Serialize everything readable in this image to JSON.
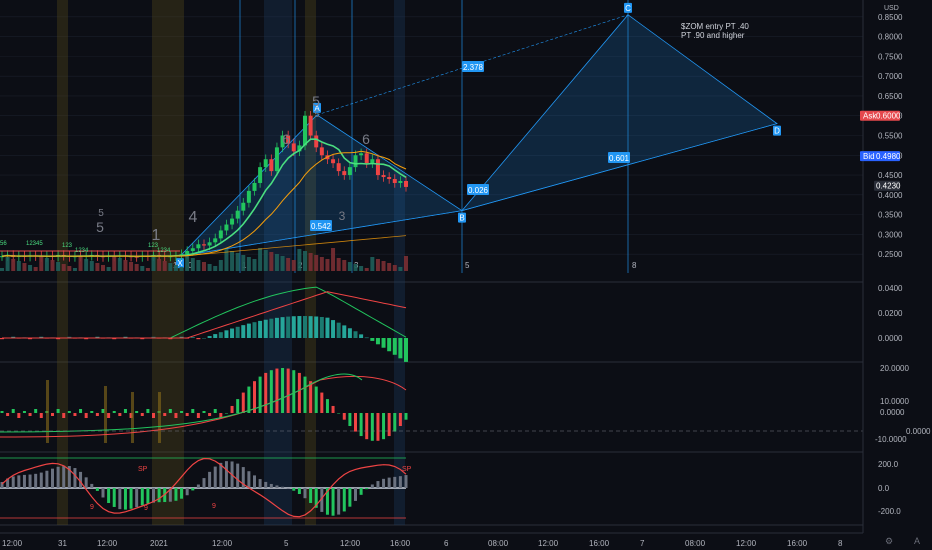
{
  "currency_label": "USD",
  "annotation": {
    "line1": "$ZOM entry PT .40",
    "line2": "PT .90 and higher"
  },
  "bid_ask": {
    "ask_label": "Ask",
    "ask_value": "0.6000",
    "bid_label": "Bid",
    "bid_value": "0.4980",
    "last_value": "0.4230",
    "ask_color": "#e5484d",
    "bid_color": "#2962ff"
  },
  "icons": {
    "settings": "gear-icon",
    "scale_toggle": "auto-scale-icon"
  },
  "colors": {
    "background": "#0c0e15",
    "up": "#22c55e",
    "down": "#ef4444",
    "pattern": "#2196f3",
    "fib_label_bg": "#2196f3"
  },
  "price_axis": {
    "labels": [
      "0.8500",
      "0.8000",
      "0.7500",
      "0.7000",
      "0.6500",
      "0.6000",
      "0.5500",
      "0.5000",
      "0.4500",
      "0.4000",
      "0.3500",
      "0.3000",
      "0.2500"
    ]
  },
  "time_axis": {
    "labels": [
      "12:00",
      "31",
      "12:00",
      "2021",
      "12:00",
      "5",
      "12:00",
      "16:00",
      "6",
      "08:00",
      "12:00",
      "16:00",
      "7",
      "08:00",
      "12:00",
      "16:00",
      "8"
    ]
  },
  "harmonic_pattern": {
    "points": [
      "X",
      "A",
      "B",
      "C",
      "D"
    ],
    "ratios": [
      "2.378",
      "0.542",
      "0.026",
      "0.601"
    ]
  },
  "wave_counts": [
    "5",
    "5",
    "1",
    "4",
    "6",
    "5",
    "6",
    "3",
    "5"
  ],
  "vertical_markers": [
    "5",
    "8",
    "1",
    "2",
    "3",
    "0",
    "1"
  ],
  "td_counts": [
    "56",
    "12345",
    "123",
    "1234",
    "123",
    "1234"
  ],
  "panes": [
    {
      "name": "macd",
      "axis_labels": [
        "0.0400",
        "0.0200",
        "0.0000"
      ]
    },
    {
      "name": "oscillator",
      "axis_labels": [
        "20.0000",
        "10.0000",
        "0.0000",
        "-10.0000"
      ],
      "side_label": "0.0000"
    },
    {
      "name": "cci",
      "axis_labels": [
        "200.0",
        "0.0",
        "-200.0"
      ],
      "markers": [
        "SP",
        "9",
        "9",
        "9",
        "SP"
      ]
    }
  ],
  "chart_data": {
    "type": "candlestick",
    "symbol": "ZOM",
    "currency": "USD",
    "ylim": [
      0.22,
      0.87
    ],
    "price_ticks": [
      0.85,
      0.8,
      0.75,
      0.7,
      0.65,
      0.6,
      0.55,
      0.5,
      0.45,
      0.4,
      0.35,
      0.3,
      0.25
    ],
    "close": [
      0.245,
      0.248,
      0.243,
      0.246,
      0.244,
      0.247,
      0.245,
      0.243,
      0.246,
      0.244,
      0.248,
      0.246,
      0.243,
      0.245,
      0.244,
      0.246,
      0.248,
      0.245,
      0.243,
      0.246,
      0.244,
      0.247,
      0.245,
      0.244,
      0.243,
      0.246,
      0.245,
      0.248,
      0.246,
      0.244,
      0.245,
      0.247,
      0.25,
      0.258,
      0.265,
      0.275,
      0.272,
      0.28,
      0.29,
      0.31,
      0.325,
      0.34,
      0.36,
      0.38,
      0.41,
      0.43,
      0.47,
      0.49,
      0.46,
      0.52,
      0.55,
      0.53,
      0.51,
      0.525,
      0.6,
      0.55,
      0.52,
      0.5,
      0.49,
      0.48,
      0.46,
      0.45,
      0.47,
      0.5,
      0.505,
      0.48,
      0.49,
      0.45,
      0.445,
      0.44,
      0.43,
      0.435,
      0.42
    ],
    "ask": 0.6,
    "bid": 0.498,
    "last": 0.423,
    "harmonic_xabcd": [
      {
        "label": "X",
        "price": 0.245
      },
      {
        "label": "A",
        "price": 0.602
      },
      {
        "label": "B",
        "price": 0.36
      },
      {
        "label": "C",
        "price": 0.855
      },
      {
        "label": "D",
        "price": 0.58
      }
    ],
    "fib_ratios": [
      2.378,
      0.542,
      0.026,
      0.601
    ]
  }
}
